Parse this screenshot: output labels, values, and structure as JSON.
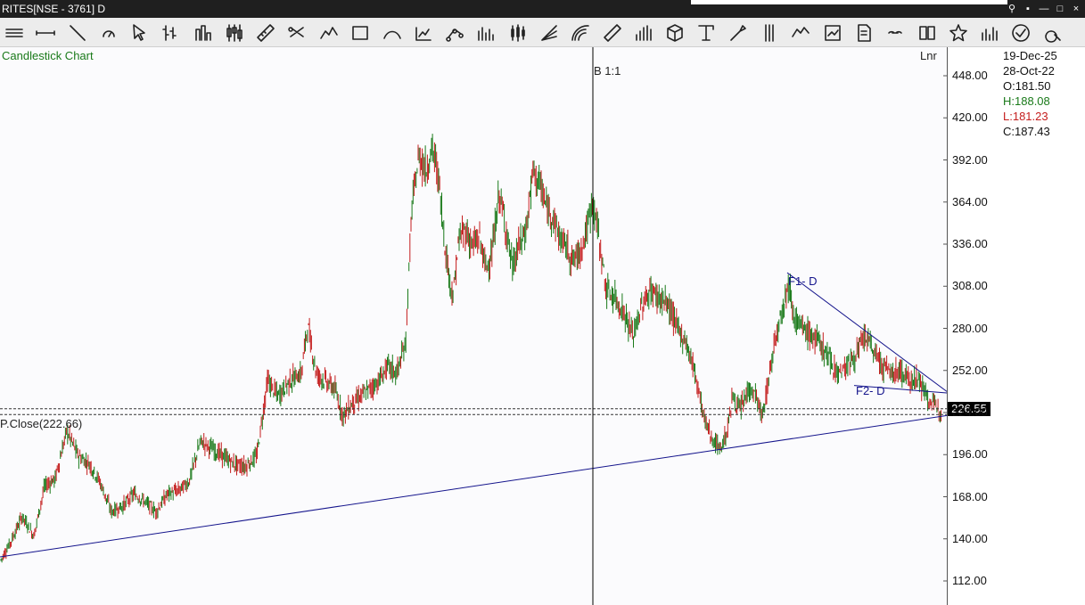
{
  "window": {
    "title": "RITES[NSE - 3761] D",
    "buttons": [
      "⚲",
      "▪",
      "—",
      "□",
      "×"
    ]
  },
  "toolbar": {
    "tools": [
      "menu-lines-icon",
      "horizontal-line-icon",
      "trend-line-icon",
      "gauge-icon",
      "cursor-icon",
      "ohlc-bars-icon",
      "bar-chart-icon",
      "candlestick-icon",
      "ruler-icon",
      "scissors-icon",
      "zigzag-icon",
      "rectangle-icon",
      "arc-icon",
      "area-chart-icon",
      "scatter-icon",
      "histogram-icon",
      "colored-candles-icon",
      "fan-lines-icon",
      "fibonacci-arc-icon",
      "measure-icon",
      "volume-bars-icon",
      "cube-icon",
      "text-icon",
      "tools-icon",
      "parallel-lines-icon",
      "pattern-icon",
      "expand-icon",
      "script-icon",
      "link-icon",
      "book-icon",
      "star-icon",
      "indicator-icon",
      "compare-icon",
      "zoom-icon"
    ]
  },
  "chart": {
    "type_label": "Candlestick Chart",
    "scale_label": "Lnr",
    "cursor_label": "B 1:1",
    "prev_close_label": "P.Close(222.66)",
    "current_price": "226.55",
    "annotations": {
      "f1": "F1- D",
      "f2": "F2- D"
    }
  },
  "info": {
    "date": "19-Dec-25",
    "bar_date": "28-Oct-22",
    "open": "O:181.50",
    "high": "H:188.08",
    "low": "L:181.23",
    "close": "C:187.43"
  },
  "colors": {
    "up": "#1a7a1a",
    "down": "#c41e1e",
    "trendline": "#14148c",
    "high_color": "#1a7a1a",
    "low_color": "#c41e1e"
  },
  "chart_data": {
    "type": "candlestick",
    "title": "Candlestick Chart",
    "ylim": [
      112,
      448
    ],
    "yticks": [
      "448.00",
      "420.00",
      "392.00",
      "364.00",
      "336.00",
      "308.00",
      "280.00",
      "252.00",
      "224.00",
      "196.00",
      "168.00",
      "140.00",
      "112.00"
    ],
    "scale": "linear",
    "prev_close": 222.66,
    "last_price": 226.55,
    "price_path": [
      [
        0,
        125
      ],
      [
        12,
        138
      ],
      [
        25,
        155
      ],
      [
        38,
        142
      ],
      [
        50,
        175
      ],
      [
        62,
        180
      ],
      [
        75,
        212
      ],
      [
        88,
        195
      ],
      [
        100,
        190
      ],
      [
        112,
        178
      ],
      [
        125,
        158
      ],
      [
        138,
        162
      ],
      [
        150,
        170
      ],
      [
        162,
        165
      ],
      [
        175,
        158
      ],
      [
        188,
        170
      ],
      [
        200,
        172
      ],
      [
        212,
        178
      ],
      [
        225,
        205
      ],
      [
        238,
        200
      ],
      [
        250,
        195
      ],
      [
        262,
        190
      ],
      [
        275,
        188
      ],
      [
        288,
        195
      ],
      [
        300,
        245
      ],
      [
        312,
        235
      ],
      [
        325,
        245
      ],
      [
        338,
        250
      ],
      [
        345,
        282
      ],
      [
        355,
        250
      ],
      [
        365,
        245
      ],
      [
        375,
        240
      ],
      [
        385,
        222
      ],
      [
        395,
        230
      ],
      [
        405,
        235
      ],
      [
        415,
        240
      ],
      [
        425,
        245
      ],
      [
        435,
        255
      ],
      [
        445,
        250
      ],
      [
        455,
        270
      ],
      [
        462,
        360
      ],
      [
        470,
        395
      ],
      [
        478,
        385
      ],
      [
        485,
        400
      ],
      [
        492,
        380
      ],
      [
        500,
        330
      ],
      [
        508,
        300
      ],
      [
        515,
        340
      ],
      [
        522,
        345
      ],
      [
        530,
        335
      ],
      [
        538,
        340
      ],
      [
        545,
        320
      ],
      [
        552,
        330
      ],
      [
        560,
        370
      ],
      [
        568,
        345
      ],
      [
        575,
        320
      ],
      [
        582,
        335
      ],
      [
        590,
        345
      ],
      [
        598,
        385
      ],
      [
        606,
        375
      ],
      [
        613,
        360
      ],
      [
        620,
        355
      ],
      [
        628,
        340
      ],
      [
        635,
        335
      ],
      [
        642,
        325
      ],
      [
        650,
        330
      ],
      [
        658,
        345
      ],
      [
        665,
        365
      ],
      [
        672,
        340
      ],
      [
        680,
        305
      ],
      [
        690,
        300
      ],
      [
        700,
        290
      ],
      [
        710,
        275
      ],
      [
        720,
        295
      ],
      [
        730,
        305
      ],
      [
        740,
        300
      ],
      [
        750,
        295
      ],
      [
        760,
        280
      ],
      [
        770,
        270
      ],
      [
        780,
        250
      ],
      [
        790,
        220
      ],
      [
        800,
        205
      ],
      [
        808,
        200
      ],
      [
        815,
        210
      ],
      [
        822,
        235
      ],
      [
        830,
        225
      ],
      [
        840,
        240
      ],
      [
        848,
        235
      ],
      [
        855,
        220
      ],
      [
        862,
        245
      ],
      [
        870,
        275
      ],
      [
        878,
        295
      ],
      [
        885,
        310
      ],
      [
        892,
        285
      ],
      [
        900,
        280
      ],
      [
        910,
        275
      ],
      [
        920,
        270
      ],
      [
        930,
        260
      ],
      [
        940,
        250
      ],
      [
        950,
        255
      ],
      [
        960,
        262
      ],
      [
        970,
        275
      ],
      [
        980,
        265
      ],
      [
        990,
        255
      ],
      [
        1000,
        250
      ],
      [
        1010,
        252
      ],
      [
        1020,
        245
      ],
      [
        1028,
        248
      ],
      [
        1035,
        240
      ],
      [
        1042,
        232
      ],
      [
        1050,
        227
      ],
      [
        1056,
        226.55
      ]
    ],
    "trendlines": [
      {
        "from": [
          0,
          128
        ],
        "to": [
          1062,
          222
        ]
      },
      {
        "from": [
          883,
          317
        ],
        "to": [
          1062,
          238
        ]
      },
      {
        "from": [
          958,
          242
        ],
        "to": [
          1062,
          237
        ]
      }
    ],
    "cursor_bar_date": "28-Oct-22",
    "ohlc": {
      "open": 181.5,
      "high": 188.08,
      "low": 181.23,
      "close": 187.43
    }
  }
}
